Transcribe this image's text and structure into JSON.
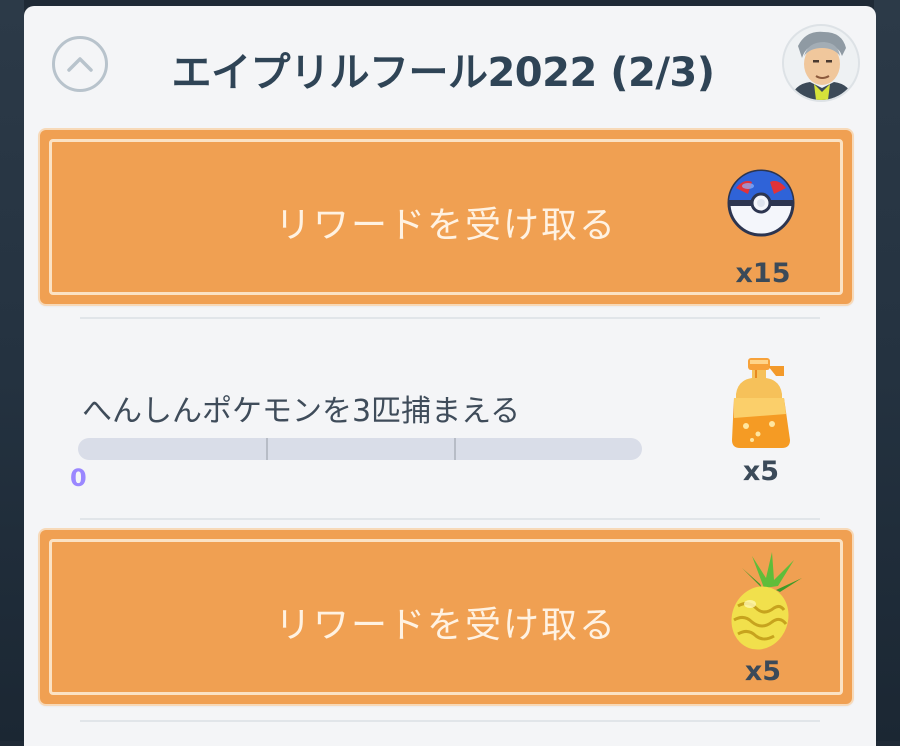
{
  "quest": {
    "title": "エイプリルフール2022 (2/3)"
  },
  "rewards": [
    {
      "label": "リワードを受け取る",
      "item_icon": "great-ball-icon",
      "count": "x15"
    },
    {
      "label": "リワードを受け取る",
      "item_icon": "pinap-berry-icon",
      "count": "x5"
    }
  ],
  "task": {
    "description": "へんしんポケモンを3匹捕まえる",
    "progress_value": "0",
    "progress_fraction": 0,
    "progress_segments": 3,
    "reward_icon": "potion-icon",
    "reward_count": "x5"
  },
  "colors": {
    "reward_card": "#f0a052",
    "title_text": "#2f4456",
    "progress_value": "#9a87ff"
  }
}
